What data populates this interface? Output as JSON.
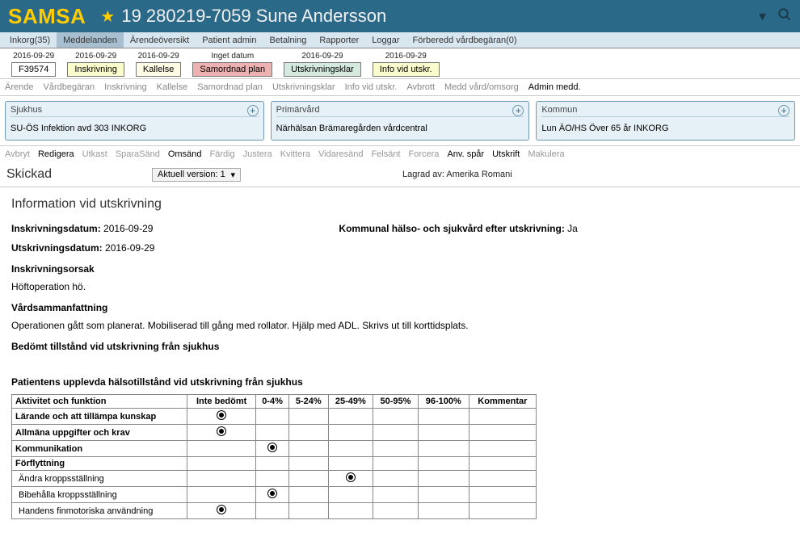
{
  "header": {
    "logo": "SAMSA",
    "patient": "19 280219-7059 Sune Andersson"
  },
  "menu": [
    {
      "label": "Inkorg(35)"
    },
    {
      "label": "Meddelanden",
      "active": true
    },
    {
      "label": "Ärendeöversikt"
    },
    {
      "label": "Patient admin"
    },
    {
      "label": "Betalning"
    },
    {
      "label": "Rapporter"
    },
    {
      "label": "Loggar"
    },
    {
      "label": "Förberedd vårdbegäran(0)"
    }
  ],
  "timeline": [
    {
      "date": "2016-09-29",
      "label": "F39574",
      "class": "tl-white"
    },
    {
      "date": "2016-09-29",
      "label": "Inskrivning",
      "class": "tl-yellow"
    },
    {
      "date": "2016-09-29",
      "label": "Kallelse",
      "class": "tl-lyellow"
    },
    {
      "date": "Inget datum",
      "label": "Samordnad plan",
      "class": "tl-pink"
    },
    {
      "date": "2016-09-29",
      "label": "Utskrivningsklar",
      "class": "tl-blue"
    },
    {
      "date": "2016-09-29",
      "label": "Info vid utskr.",
      "class": "tl-yellow"
    }
  ],
  "subtabs": [
    {
      "label": "Ärende"
    },
    {
      "label": "Vårdbegäran"
    },
    {
      "label": "Inskrivning"
    },
    {
      "label": "Kallelse"
    },
    {
      "label": "Samordnad plan"
    },
    {
      "label": "Utskrivningsklar"
    },
    {
      "label": "Info vid utskr."
    },
    {
      "label": "Avbrott"
    },
    {
      "label": "Medd vård/omsorg"
    },
    {
      "label": "Admin medd.",
      "active": true
    }
  ],
  "orgs": [
    {
      "title": "Sjukhus",
      "value": "SU-ÖS Infektion avd 303 INKORG"
    },
    {
      "title": "Primärvård",
      "value": "Närhälsan Brämaregården vårdcentral"
    },
    {
      "title": "Kommun",
      "value": "Lun ÄO/HS Över 65 år INKORG"
    }
  ],
  "actions": [
    {
      "label": "Avbryt"
    },
    {
      "label": "Redigera",
      "active": true
    },
    {
      "label": "Utkast"
    },
    {
      "label": "SparaSänd"
    },
    {
      "label": "Omsänd",
      "active": true
    },
    {
      "label": "Färdig"
    },
    {
      "label": "Justera"
    },
    {
      "label": "Kvittera"
    },
    {
      "label": "Vidaresänd"
    },
    {
      "label": "Felsänt"
    },
    {
      "label": "Forcera"
    },
    {
      "label": "Anv. spår",
      "active": true
    },
    {
      "label": "Utskrift",
      "active": true
    },
    {
      "label": "Makulera"
    }
  ],
  "status": {
    "label": "Skickad",
    "version": "Aktuell version: 1",
    "stored_by": "Lagrad av: Amerika Romani"
  },
  "content": {
    "heading": "Information vid utskrivning",
    "fields": {
      "inskrivning_lbl": "Inskrivningsdatum:",
      "inskrivning_val": "2016-09-29",
      "kommunal_lbl": "Kommunal hälso- och sjukvård efter utskrivning:",
      "kommunal_val": "Ja",
      "utskrivning_lbl": "Utskrivningsdatum:",
      "utskrivning_val": "2016-09-29",
      "orsak_lbl": "Inskrivningsorsak",
      "orsak_val": "Höftoperation hö.",
      "vards_lbl": "Vårdsammanfattning",
      "vards_val": "Operationen gått som planerat. Mobiliserad till gång med rollator. Hjälp med ADL. Skrivs ut till korttidsplats.",
      "bedomt_lbl": "Bedömt tillstånd vid utskrivning från sjukhus",
      "patient_lbl": "Patientens upplevda hälsotillstånd vid utskrivning från sjukhus"
    },
    "table": {
      "cols": [
        "Aktivitet och funktion",
        "Inte bedömt",
        "0-4%",
        "5-24%",
        "25-49%",
        "50-95%",
        "96-100%",
        "Kommentar"
      ],
      "rows": [
        {
          "label": "Lärande och att tillämpa kunskap",
          "sel": 1,
          "group": true
        },
        {
          "label": "Allmäna uppgifter och krav",
          "sel": 1,
          "group": true
        },
        {
          "label": "Kommunikation",
          "sel": 2,
          "group": true
        },
        {
          "label": "Förflyttning",
          "sel": null,
          "group": true
        },
        {
          "label": "Ändra kroppsställning",
          "sel": 4,
          "group": false
        },
        {
          "label": "Bibehålla kroppsställning",
          "sel": 2,
          "group": false
        },
        {
          "label": "Handens finmotoriska användning",
          "sel": 1,
          "group": false
        }
      ]
    }
  }
}
